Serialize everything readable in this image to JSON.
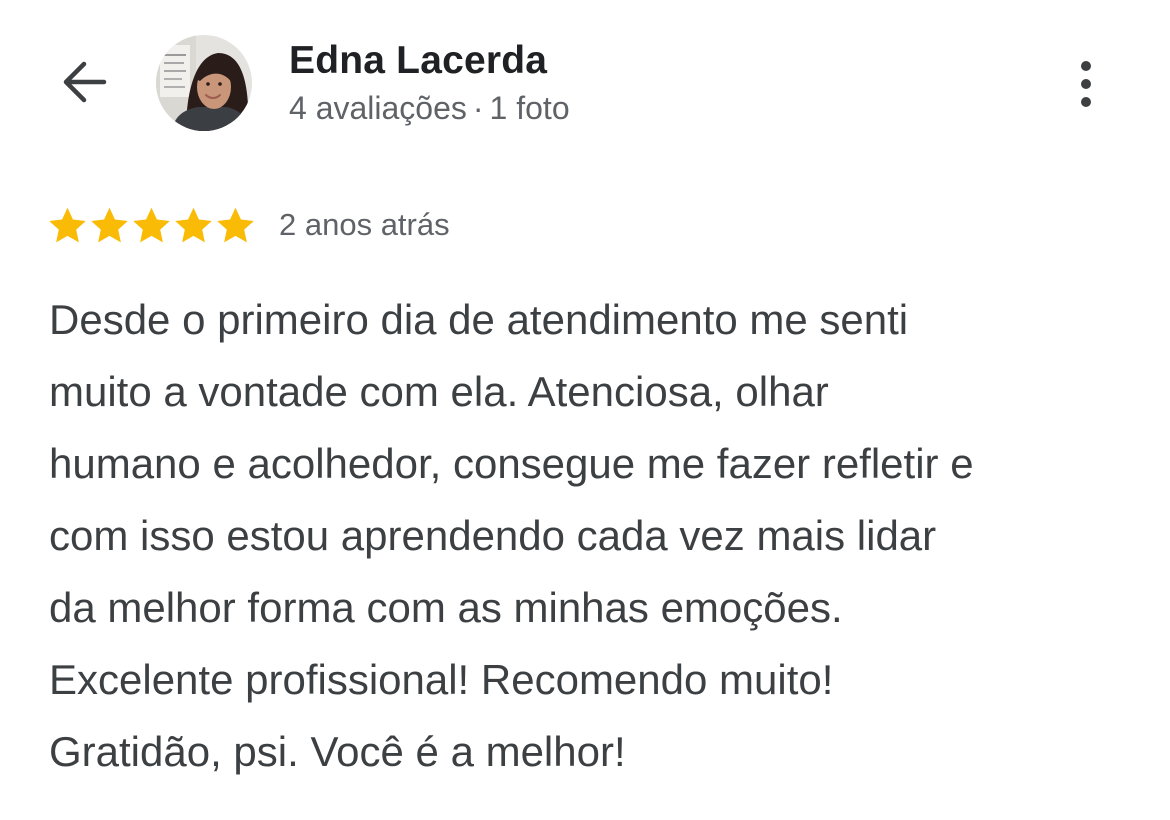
{
  "header": {
    "back_icon": "arrow-left-icon",
    "avatar_alt": "Edna Lacerda",
    "reviewer_name": "Edna Lacerda",
    "review_count": "4 avaliações",
    "separator": "·",
    "photo_count": "1 foto",
    "more_icon": "more-vertical-icon"
  },
  "review": {
    "rating": 5,
    "rating_max": 5,
    "star_color": "#f9bb05",
    "date": "2 anos atrás",
    "text_lines": [
      "Desde o primeiro dia de atendimento me senti",
      "muito a vontade com ela. Atenciosa, olhar",
      "humano e acolhedor, consegue me fazer refletir e",
      "com isso estou aprendendo cada vez mais lidar",
      "da melhor forma com as minhas emoções.",
      "Excelente profissional! Recomendo muito!",
      "Gratidão, psi. Você é a melhor!"
    ]
  },
  "colors": {
    "name": "#202124",
    "secondary_text": "#5f6368",
    "body_text": "#3c4043",
    "icon": "#3c4043"
  }
}
